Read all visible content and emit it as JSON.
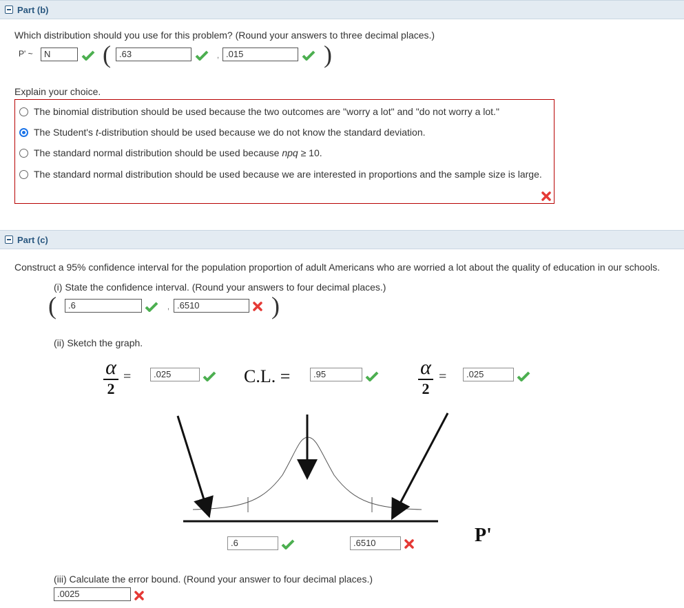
{
  "part_b": {
    "header": "Part (b)",
    "question": "Which distribution should you use for this problem? (Round your answers to three decimal places.)",
    "p_label": "P' ~",
    "dist_value": "N",
    "mean_value": ".63",
    "sd_value": ".015",
    "comma": ",",
    "explain_label": "Explain your choice.",
    "choices": [
      {
        "text": "The binomial distribution should be used because the two outcomes are \"worry a lot\" and \"do not worry a lot.\"",
        "selected": false
      },
      {
        "text_before": "The Student's ",
        "text_em": "t",
        "text_after": "-distribution should be used because we do not know the standard deviation.",
        "selected": true
      },
      {
        "text_before": "The standard normal distribution should be used because ",
        "text_em": "npq",
        "text_after": " ≥ 10.",
        "selected": false
      },
      {
        "text": "The standard normal distribution should be used because we are interested in proportions and the sample size is large.",
        "selected": false
      }
    ]
  },
  "part_c": {
    "header": "Part (c)",
    "question": "Construct a 95% confidence interval for the population proportion of adult Americans who are worried a lot about the quality of education in our schools.",
    "sub_i": "(i) State the confidence interval. (Round your answers to four decimal places.)",
    "ci_lower": ".6",
    "ci_upper": ".6510",
    "comma": ",",
    "sub_ii": "(ii) Sketch the graph.",
    "alpha_symbol": "α",
    "two": "2",
    "equals": "=",
    "left_tail": ".025",
    "cl_label": "C.L. =",
    "cl_value": ".95",
    "right_tail": ".025",
    "graph_lower": ".6",
    "graph_upper": ".6510",
    "axis_label": "P'",
    "sub_iii": "(iii) Calculate the error bound. (Round your answer to four decimal places.)",
    "error_bound": ".0025"
  },
  "colors": {
    "header_bg": "#e3ebf2",
    "header_text": "#29577f",
    "correct": "#4caf50",
    "incorrect": "#e53935",
    "selected_radio": "#1a73e8"
  }
}
